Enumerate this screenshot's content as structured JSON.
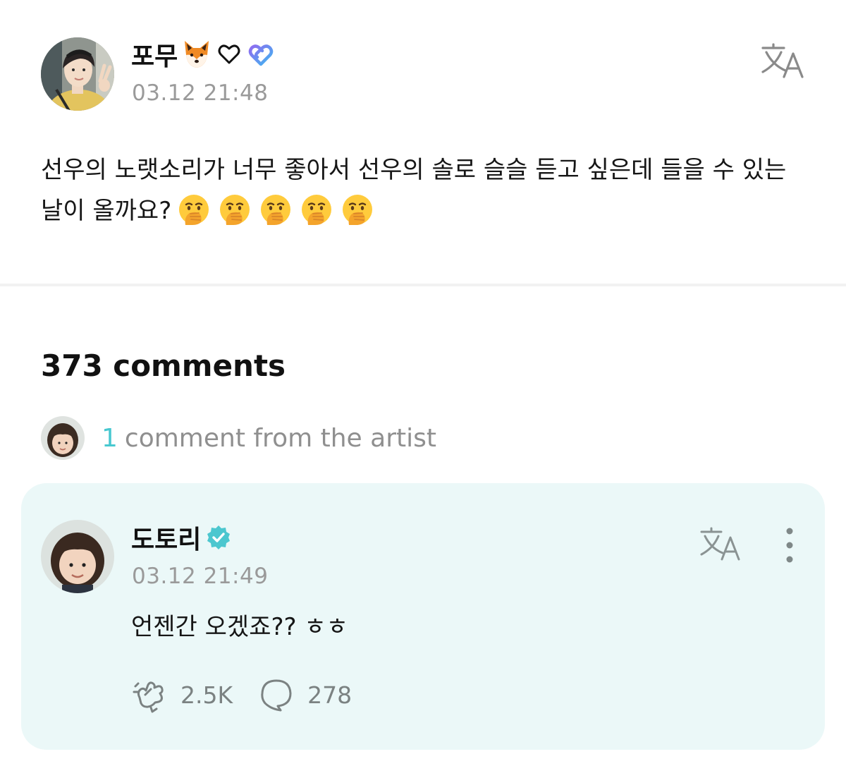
{
  "post": {
    "author": "포무",
    "author_emoji": "fox-face-emoji",
    "time": "03.12 21:48",
    "text": "선우의 노랫소리가 너무 좋아서 선우의 솔로 슬슬 듣고 싶은데 들을 수 있는 날이 올까요?",
    "trailing_emoji": [
      "face-with-hand-over-mouth",
      "face-with-hand-over-mouth",
      "face-with-hand-over-mouth",
      "face-with-hand-over-mouth",
      "face-with-hand-over-mouth"
    ]
  },
  "comments": {
    "count_label": "373 comments",
    "artist_summary": {
      "count": "1",
      "text": "comment from the artist"
    }
  },
  "artist_comment": {
    "author": "도토리",
    "time": "03.12 21:49",
    "text": "언젠간 오겠죠?? ㅎㅎ",
    "likes": "2.5K",
    "replies": "278"
  },
  "colors": {
    "accent": "#48c8d0",
    "card_background": "#ebf8f8",
    "muted_text": "#9a9a9a"
  }
}
